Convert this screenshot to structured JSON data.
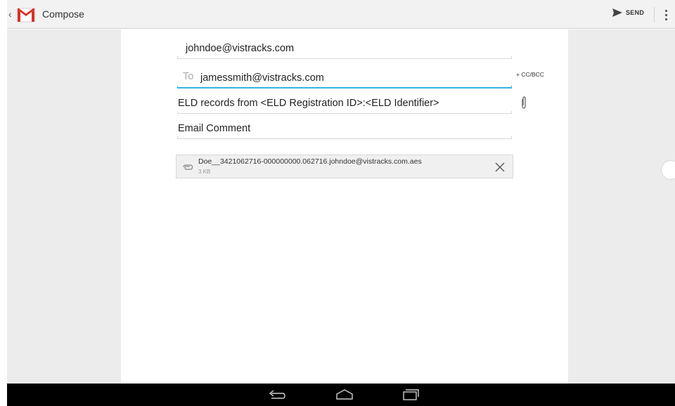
{
  "app_bar": {
    "title": "Compose",
    "send_label": "SEND",
    "icons": {
      "back": "chevron-left-icon",
      "logo": "gmail-logo-icon",
      "send": "send-arrow-icon",
      "more": "overflow-menu-icon"
    }
  },
  "compose": {
    "from": "johndoe@vistracks.com",
    "to_label": "To",
    "to": "jamessmith@vistracks.com",
    "cc_bcc_label": "+ CC/BCC",
    "subject": "ELD records from <ELD Registration ID>:<ELD Identifier>",
    "body": "Email Comment",
    "attachment": {
      "name": "Doe__3421062716-000000000.062716.johndoe@vistracks.com.aes",
      "size": "3 KB"
    }
  },
  "colors": {
    "accent": "#33b5e5",
    "gmail_red": "#d93025",
    "gutter": "#ececec",
    "navbar": "#000000"
  },
  "navbar": {
    "icons": [
      "back-icon",
      "home-icon",
      "recent-apps-icon"
    ]
  }
}
